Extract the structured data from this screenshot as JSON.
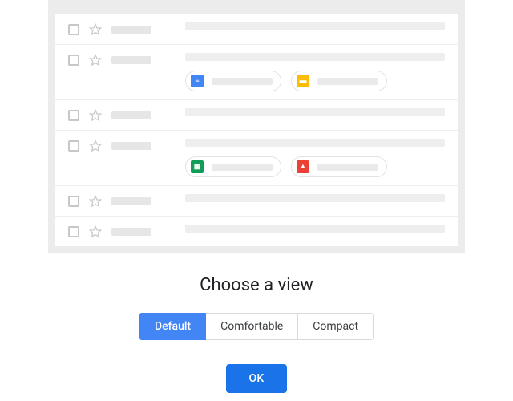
{
  "heading": "Choose a view",
  "options": {
    "default": {
      "label": "Default",
      "selected": true
    },
    "comfortable": {
      "label": "Comfortable",
      "selected": false
    },
    "compact": {
      "label": "Compact",
      "selected": false
    }
  },
  "ok_label": "OK",
  "preview_rows": [
    {
      "attachments": []
    },
    {
      "attachments": [
        {
          "kind": "doc",
          "icon": "docs-icon"
        },
        {
          "kind": "slide",
          "icon": "slides-icon"
        }
      ]
    },
    {
      "attachments": []
    },
    {
      "attachments": [
        {
          "kind": "sheet",
          "icon": "sheets-icon"
        },
        {
          "kind": "image",
          "icon": "image-icon"
        }
      ]
    },
    {
      "attachments": []
    },
    {
      "attachments": []
    }
  ],
  "icons": {
    "doc": {
      "glyph": "≡",
      "color": "#4285f4"
    },
    "slide": {
      "glyph": "▬",
      "color": "#fbbc04"
    },
    "sheet": {
      "glyph": "▦",
      "color": "#0f9d58"
    },
    "image": {
      "glyph": "▲",
      "color": "#ea4335"
    }
  }
}
